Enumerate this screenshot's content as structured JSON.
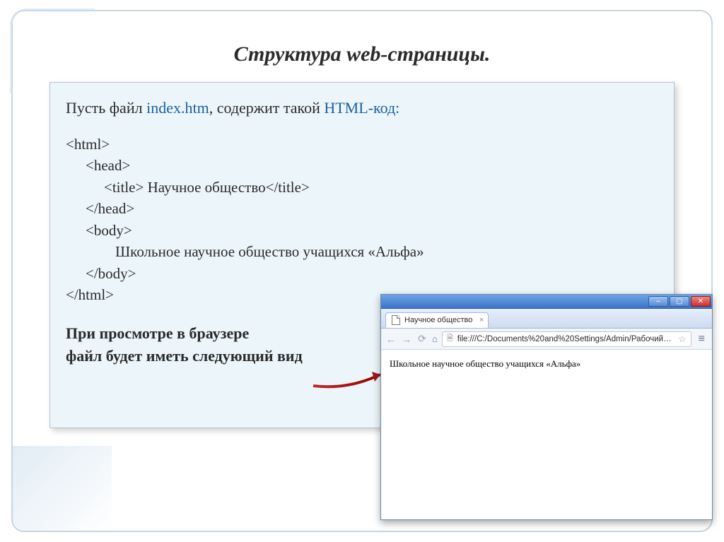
{
  "title": "Структура web-страницы.",
  "intro": {
    "prefix": "Пусть  файл ",
    "file": "index.htm",
    "mid": ", содержит такой ",
    "hl_lang": "HTML",
    "hl_suffix": "-код:"
  },
  "code": {
    "l1": "<html>",
    "l2": "<head>",
    "l3_open": "<title>",
    "l3_text": " Научное общество",
    "l3_close": "</title>",
    "l4": "</head>",
    "l5": "<body>",
    "l6": "Школьное научное общество учащихся «Альфа»",
    "l7": "</body>",
    "l8": "</html>"
  },
  "note_line1": "При просмотре в браузере",
  "note_line2": " файл будет иметь следующий вид",
  "browser": {
    "tab_title": "Научное общество",
    "url": "file:///C:/Documents%20and%20Settings/Admin/Рабочий%2…",
    "page_text": "Школьное научное общество учащихся «Альфа»"
  },
  "win_buttons": {
    "min": "–",
    "max": "▢",
    "close": "✕"
  }
}
